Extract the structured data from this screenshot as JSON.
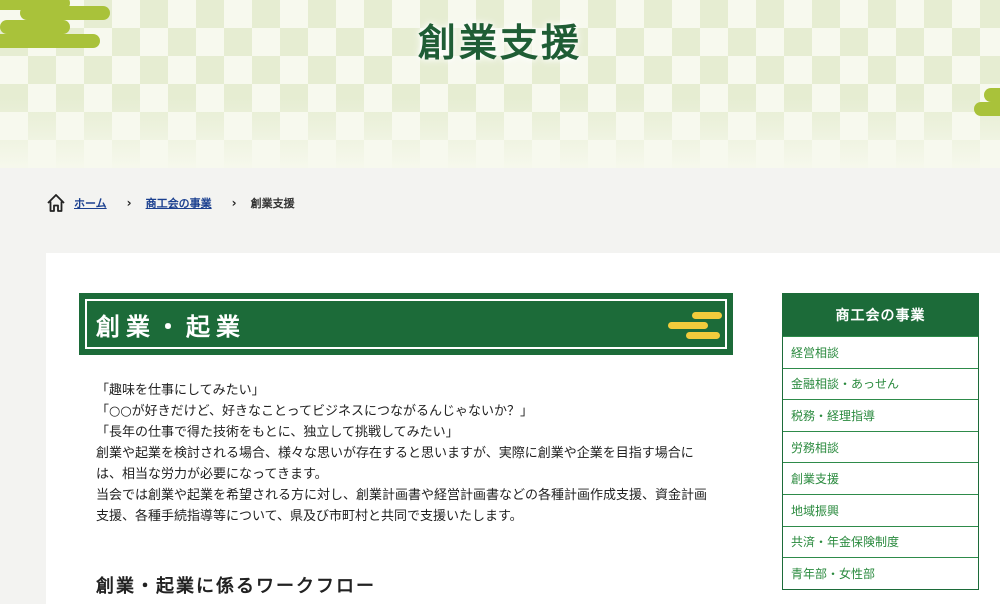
{
  "header": {
    "title": "創業支援"
  },
  "breadcrumb": {
    "home": "ホーム",
    "parent": "商工会の事業",
    "current": "創業支援"
  },
  "section": {
    "heading": "創業・起業"
  },
  "body": {
    "lines": [
      "「趣味を仕事にしてみたい」",
      "「○○が好きだけど、好きなことってビジネスにつながるんじゃないか？」",
      "「長年の仕事で得た技術をもとに、独立して挑戦してみたい」",
      "創業や起業を検討される場合、様々な思いが存在すると思いますが、実際に創業や企業を目指す場合に",
      "は、相当な労力が必要になってきます。",
      "当会では創業や起業を希望される方に対し、創業計画書や経営計画書などの各種計画作成支援、資金計画",
      "支援、各種手続指導等について、県及び市町村と共同で支援いたします。"
    ],
    "subheading": "創業・起業に係るワークフロー"
  },
  "sidebar": {
    "title": "商工会の事業",
    "items": [
      {
        "label": "経営相談"
      },
      {
        "label": "金融相談・あっせん"
      },
      {
        "label": "税務・経理指導"
      },
      {
        "label": "労務相談"
      },
      {
        "label": "創業支援"
      },
      {
        "label": "地域振興"
      },
      {
        "label": "共済・年金保険制度"
      },
      {
        "label": "青年部・女性部"
      }
    ]
  },
  "colors": {
    "brand_green": "#1c6b39",
    "link_green": "#2a8a3e",
    "cloud_green": "#a9c23a",
    "cloud_yellow": "#f2cc3c"
  },
  "icons": {
    "home": "home-icon",
    "separator": "chevron-right-icon"
  }
}
